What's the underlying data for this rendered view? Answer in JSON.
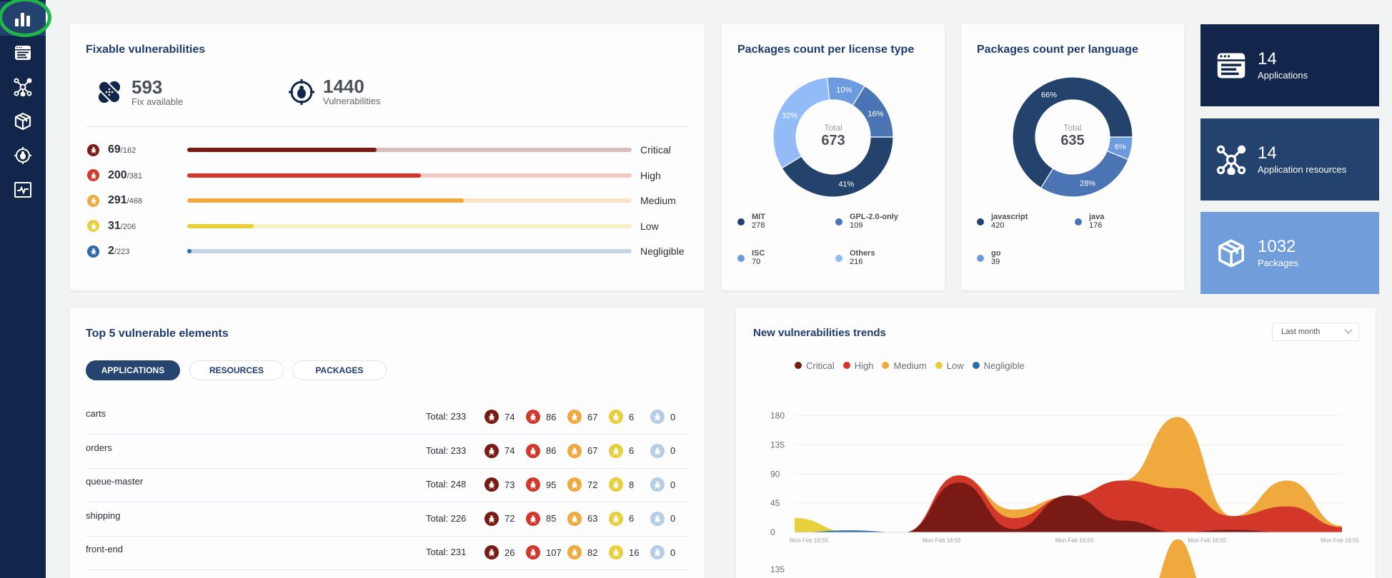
{
  "sidebar": {
    "items": [
      {
        "name": "dashboard",
        "icon": "bar-chart-icon",
        "active": true
      },
      {
        "name": "applications",
        "icon": "app-window-icon"
      },
      {
        "name": "resources",
        "icon": "network-nodes-icon"
      },
      {
        "name": "packages",
        "icon": "package-box-icon"
      },
      {
        "name": "vulnerabilities",
        "icon": "bug-target-icon"
      },
      {
        "name": "monitoring",
        "icon": "pulse-monitor-icon"
      }
    ]
  },
  "fixable": {
    "title": "Fixable vulnerabilities",
    "fix_count": "593",
    "fix_label": "Fix available",
    "vuln_count": "1440",
    "vuln_label": "Vulnerabilities",
    "severities": [
      {
        "label": "Critical",
        "fixed": "69",
        "total": "/162",
        "fraction": 0.426,
        "color": "#7a1a14",
        "track": "#dcbcbb"
      },
      {
        "label": "High",
        "fixed": "200",
        "total": "/381",
        "fraction": 0.525,
        "color": "#d2372a",
        "track": "#f3c7c2"
      },
      {
        "label": "Medium",
        "fixed": "291",
        "total": "/468",
        "fraction": 0.622,
        "color": "#f0a93d",
        "track": "#fbe3c6"
      },
      {
        "label": "Low",
        "fixed": "31",
        "total": "/206",
        "fraction": 0.15,
        "color": "#e8cf3c",
        "track": "#f8efc9"
      },
      {
        "label": "Negligible",
        "fixed": "2",
        "total": "/223",
        "fraction": 0.009,
        "color": "#2d6aa8",
        "track": "#c4d6e6"
      }
    ]
  },
  "license_chart": {
    "title": "Packages count per license type",
    "total_label": "Total",
    "total": "673",
    "slices": [
      {
        "name": "MIT",
        "value": 278,
        "pct": "41%",
        "color": "#23426c"
      },
      {
        "name": "Others",
        "value": 216,
        "pct": "32%",
        "color": "#93bbf7"
      },
      {
        "name": "ISC",
        "value": 70,
        "pct": "10%",
        "color": "#6d9be0"
      },
      {
        "name": "GPL-2.0-only",
        "value": 109,
        "pct": "16%",
        "color": "#4a74b4"
      }
    ],
    "legend": [
      {
        "name": "MIT",
        "value": "278",
        "color": "#23426c"
      },
      {
        "name": "GPL-2.0-only",
        "value": "109",
        "color": "#4a74b4"
      },
      {
        "name": "ISC",
        "value": "70",
        "color": "#6d9be0"
      },
      {
        "name": "Others",
        "value": "216",
        "color": "#93bbf7"
      }
    ]
  },
  "language_chart": {
    "title": "Packages count per language",
    "total_label": "Total",
    "total": "635",
    "slices": [
      {
        "name": "go",
        "value": 39,
        "pct": "6%",
        "color": "#6d9be0"
      },
      {
        "name": "java",
        "value": 176,
        "pct": "28%",
        "color": "#4a74b4"
      },
      {
        "name": "javascript",
        "value": 420,
        "pct": "66%",
        "color": "#23426c"
      }
    ],
    "legend": [
      {
        "name": "javascript",
        "value": "420",
        "color": "#23426c"
      },
      {
        "name": "java",
        "value": "176",
        "color": "#4a74b4"
      },
      {
        "name": "go",
        "value": "39",
        "color": "#6d9be0"
      }
    ]
  },
  "tiles": [
    {
      "count": "14",
      "label": "Applications",
      "color": "#12254a",
      "icon": "app-window-icon"
    },
    {
      "count": "14",
      "label": "Application resources",
      "color": "#24426e",
      "icon": "network-nodes-icon"
    },
    {
      "count": "1032",
      "label": "Packages",
      "color": "#729ddb",
      "icon": "package-box-icon"
    }
  ],
  "top5": {
    "title": "Top 5 vulnerable elements",
    "tabs": [
      {
        "label": "APPLICATIONS",
        "active": true
      },
      {
        "label": "RESOURCES"
      },
      {
        "label": "PACKAGES"
      }
    ],
    "total_prefix": "Total: ",
    "rows": [
      {
        "name": "carts",
        "total": "Total: 233",
        "counts": [
          "74",
          "86",
          "67",
          "6",
          "0"
        ]
      },
      {
        "name": "orders",
        "total": "Total: 233",
        "counts": [
          "74",
          "86",
          "67",
          "6",
          "0"
        ]
      },
      {
        "name": "queue-master",
        "total": "Total: 248",
        "counts": [
          "73",
          "95",
          "72",
          "8",
          "0"
        ]
      },
      {
        "name": "shipping",
        "total": "Total: 226",
        "counts": [
          "72",
          "85",
          "63",
          "6",
          "0"
        ]
      },
      {
        "name": "front-end",
        "total": "Total: 231",
        "counts": [
          "26",
          "107",
          "82",
          "16",
          "0"
        ]
      }
    ],
    "severity_colors": [
      "#7a1a14",
      "#d2372a",
      "#f0a93d",
      "#e8cf3c",
      "#b7cde3"
    ]
  },
  "trends": {
    "title": "New vulnerabilities trends",
    "range_select": "Last month"
  },
  "chart_data": {
    "type": "area",
    "title": "New vulnerabilities trends",
    "legend": [
      "Critical",
      "High",
      "Medium",
      "Low",
      "Negligible"
    ],
    "legend_position": "top-left",
    "colors": [
      "#7a1a14",
      "#d2372a",
      "#f0a93d",
      "#e8cf3c",
      "#2d6aa8"
    ],
    "yticks": [
      0,
      45,
      90,
      135,
      180
    ],
    "ylim": [
      0,
      185
    ],
    "xticks": [
      "Mon Feb 16:55",
      "Mon Feb 16:55",
      "Mon Feb 16:55",
      "Mon Feb 16:55",
      "Mon Feb 16:55"
    ],
    "x": [
      0,
      1,
      2,
      3,
      4,
      5,
      6,
      7,
      8,
      9,
      10
    ],
    "series": [
      {
        "name": "Medium",
        "values": [
          2,
          0,
          0,
          85,
          35,
          55,
          80,
          178,
          25,
          80,
          10
        ]
      },
      {
        "name": "High",
        "values": [
          2,
          0,
          0,
          88,
          22,
          55,
          80,
          68,
          25,
          40,
          8
        ]
      },
      {
        "name": "Critical",
        "values": [
          1,
          0,
          0,
          77,
          5,
          57,
          18,
          0,
          4,
          0,
          0
        ]
      },
      {
        "name": "Low",
        "values": [
          22,
          0,
          0,
          0,
          0,
          0,
          0,
          0,
          0,
          0,
          0
        ]
      },
      {
        "name": "Negligible",
        "values": [
          0,
          3,
          0,
          0,
          0,
          0,
          0,
          0,
          0,
          0,
          0
        ]
      }
    ],
    "second_panel_ytick": 135
  }
}
